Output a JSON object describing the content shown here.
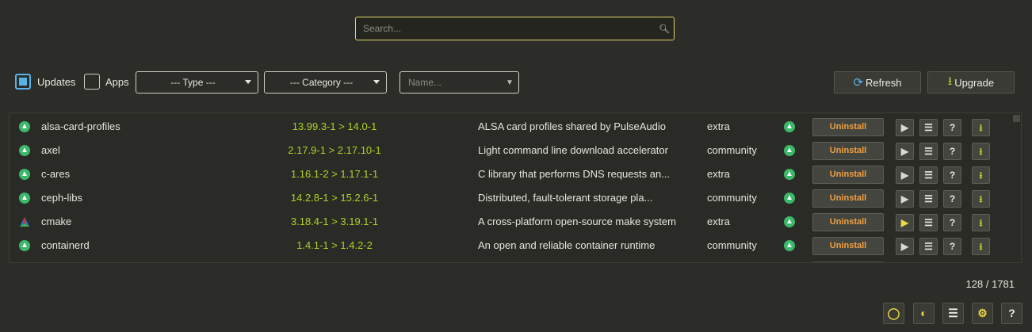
{
  "search": {
    "placeholder": "Search..."
  },
  "filters": {
    "updates_label": "Updates",
    "updates_checked": true,
    "apps_label": "Apps",
    "apps_checked": false,
    "type_selected": "--- Type ---",
    "category_selected": "--- Category ---",
    "name_placeholder": "Name..."
  },
  "actions": {
    "refresh_label": "Refresh",
    "upgrade_label": "Upgrade"
  },
  "table": {
    "uninstall_label": "Uninstall",
    "rows": [
      {
        "name": "alsa-card-profiles",
        "icon": "arch-icon",
        "version": "13.99.3-1  >  14.0-1",
        "description": "ALSA card profiles shared by PulseAudio",
        "repository": "extra"
      },
      {
        "name": "axel",
        "icon": "arch-icon",
        "version": "2.17.9-1  >  2.17.10-1",
        "description": "Light command line download accelerator",
        "repository": "community"
      },
      {
        "name": "c-ares",
        "icon": "arch-icon",
        "version": "1.16.1-2  >  1.17.1-1",
        "description": "C library that performs DNS requests an...",
        "repository": "extra"
      },
      {
        "name": "ceph-libs",
        "icon": "arch-icon",
        "version": "14.2.8-1  >  15.2.6-1",
        "description": "Distributed, fault-tolerant storage pla...",
        "repository": "community"
      },
      {
        "name": "cmake",
        "icon": "cmake-icon",
        "version": "3.18.4-1  >  3.19.1-1",
        "description": "A cross-platform open-source make system",
        "repository": "extra"
      },
      {
        "name": "containerd",
        "icon": "arch-icon",
        "version": "1.4.1-1  >  1.4.2-2",
        "description": "An open and reliable container runtime",
        "repository": "community"
      }
    ]
  },
  "footer": {
    "count": "128 / 1781"
  },
  "colors": {
    "accent": "#e2d468",
    "version": "#a9d22a",
    "uninstall": "#f0a040",
    "checkbox": "#5ab3e8",
    "background": "#2c2d28"
  }
}
